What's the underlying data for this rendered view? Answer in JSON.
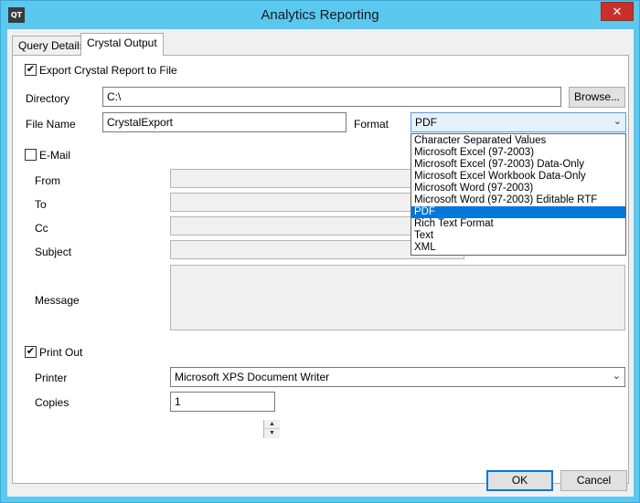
{
  "window": {
    "title": "Analytics Reporting",
    "app_icon_text": "QT",
    "close_glyph": "✕"
  },
  "tabs": [
    {
      "label": "Query Details"
    },
    {
      "label": "Crystal Output"
    }
  ],
  "export": {
    "checkbox_label": "Export Crystal Report to File",
    "checked": true,
    "directory_label": "Directory",
    "directory_value": "C:\\",
    "browse_label": "Browse...",
    "filename_label": "File Name",
    "filename_value": "CrystalExport",
    "format_label": "Format",
    "format_value": "PDF",
    "format_options": [
      "Character Separated Values",
      "Microsoft Excel (97-2003)",
      "Microsoft Excel (97-2003) Data-Only",
      "Microsoft Excel Workbook Data-Only",
      "Microsoft Word (97-2003)",
      "Microsoft Word (97-2003) Editable RTF",
      "PDF",
      "Rich Text Format",
      "Text",
      "XML"
    ]
  },
  "email": {
    "checkbox_label": "E-Mail",
    "checked": false,
    "from_label": "From",
    "to_label": "To",
    "cc_label": "Cc",
    "subject_label": "Subject",
    "message_label": "Message"
  },
  "print": {
    "checkbox_label": "Print Out",
    "checked": true,
    "printer_label": "Printer",
    "printer_value": "Microsoft XPS Document Writer",
    "copies_label": "Copies",
    "copies_value": "1"
  },
  "buttons": {
    "ok_label": "OK",
    "cancel_label": "Cancel"
  },
  "glyphs": {
    "check": "✔",
    "dropdown_arrow": "⌄",
    "spin_up": "▲",
    "spin_down": "▼"
  }
}
